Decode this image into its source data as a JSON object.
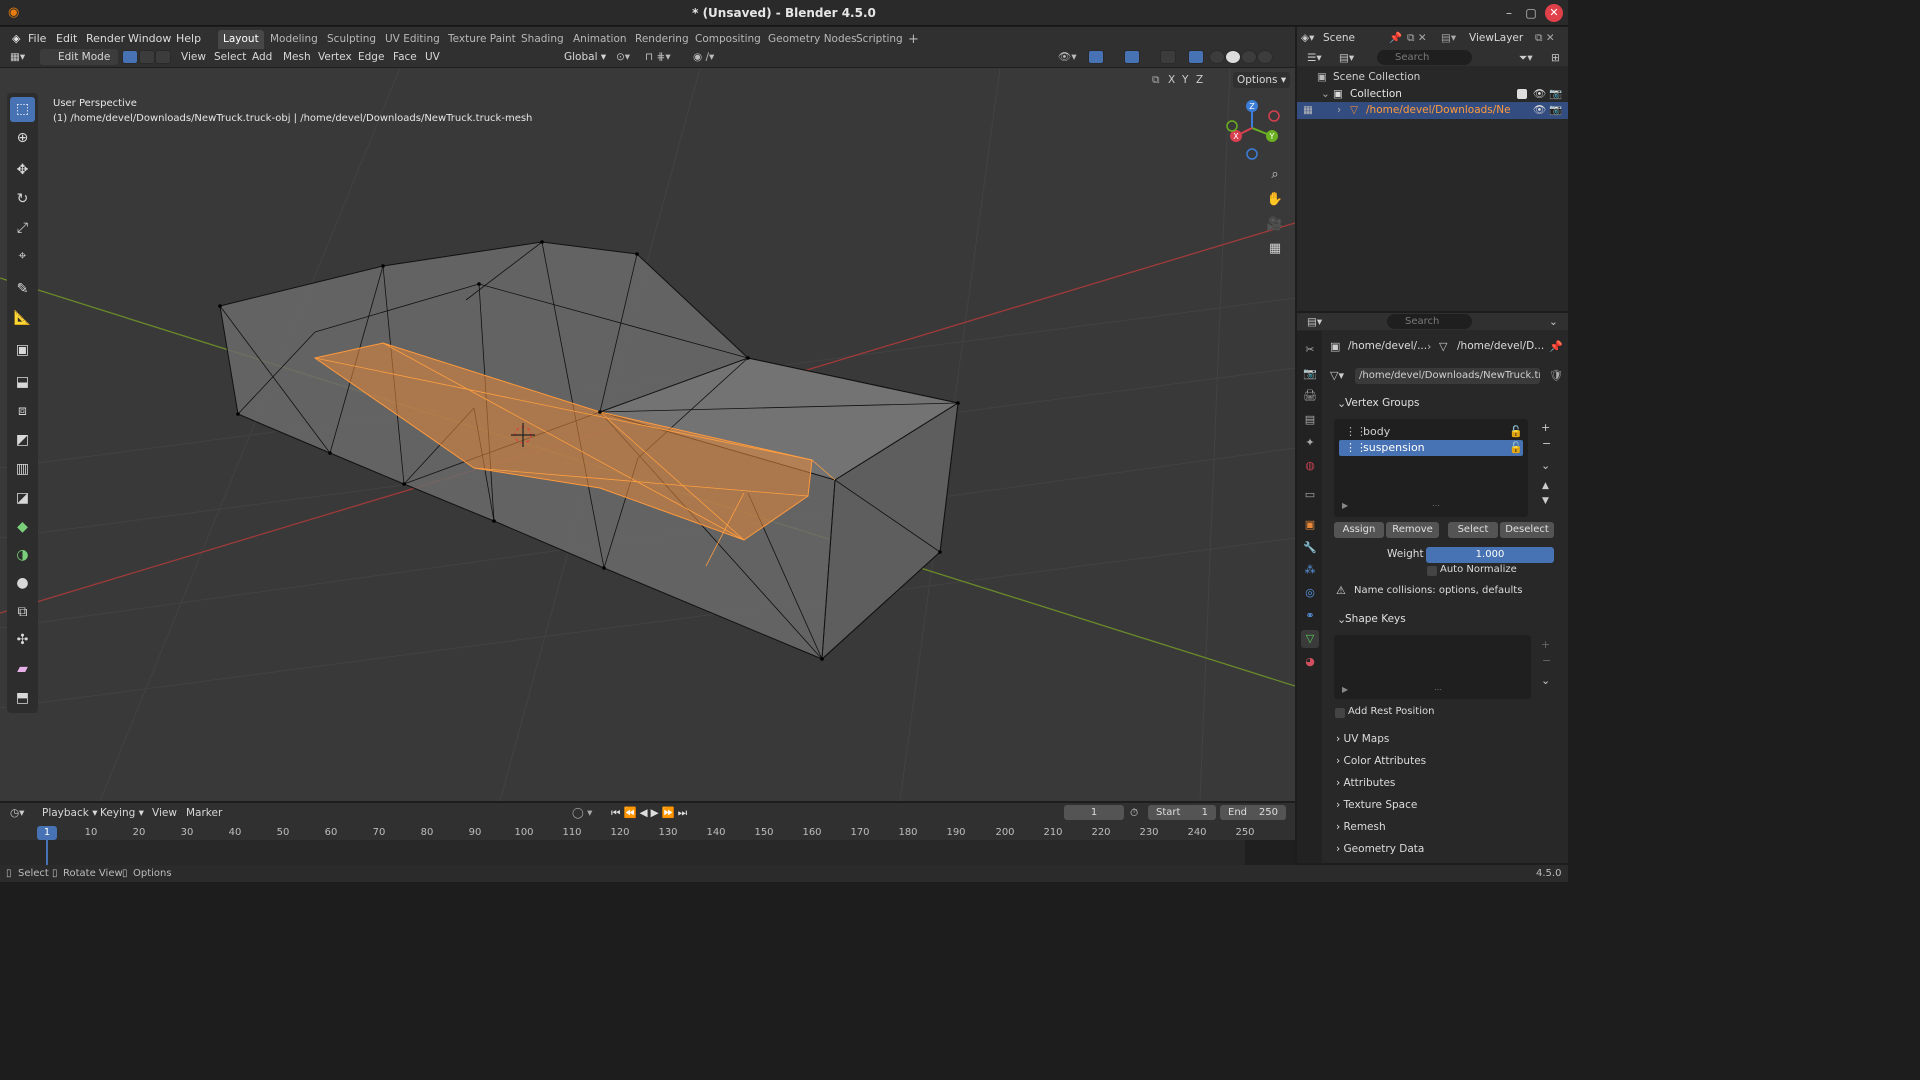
{
  "window": {
    "title": "* (Unsaved) - Blender 4.5.0",
    "min": "–",
    "max": "▢",
    "close": "✕"
  },
  "menu": {
    "items": [
      "File",
      "Edit",
      "Render",
      "Window",
      "Help"
    ]
  },
  "workspaces": [
    "Layout",
    "Modeling",
    "Sculpting",
    "UV Editing",
    "Texture Paint",
    "Shading",
    "Animation",
    "Rendering",
    "Compositing",
    "Geometry Nodes",
    "Scripting"
  ],
  "workspace_add": "+",
  "topright": {
    "scene": "Scene",
    "viewlayer": "ViewLayer"
  },
  "viewport_header": {
    "mode": "Edit Mode",
    "menus": [
      "View",
      "Select",
      "Add",
      "Mesh",
      "Vertex",
      "Edge",
      "Face",
      "UV"
    ],
    "orientation": "Global",
    "options": "Options",
    "axes": [
      "X",
      "Y",
      "Z"
    ]
  },
  "viewport": {
    "perspective": "User Perspective",
    "object_info": "(1) /home/devel/Downloads/NewTruck.truck-obj | /home/devel/Downloads/NewTruck.truck-mesh"
  },
  "gizmo": {
    "x": "X",
    "y": "Y",
    "z": "Z"
  },
  "outliner": {
    "search_placeholder": "Search",
    "scene_collection": "Scene Collection",
    "collection": "Collection",
    "object": "/home/devel/Downloads/NewTru"
  },
  "properties": {
    "search_placeholder": "Search",
    "breadcrumb1": "/home/devel/...",
    "breadcrumb2": "/home/devel/D...",
    "mesh_name": "/home/devel/Downloads/NewTruck.truc...",
    "vertex_groups_title": "Vertex Groups",
    "vertex_groups": [
      "body",
      "suspension"
    ],
    "buttons": {
      "assign": "Assign",
      "remove": "Remove",
      "select": "Select",
      "deselect": "Deselect"
    },
    "weight_label": "Weight",
    "weight_value": "1.000",
    "auto_normalize": "Auto Normalize",
    "warning": "Name collisions: options, defaults",
    "shape_keys_title": "Shape Keys",
    "add_rest_position": "Add Rest Position",
    "sections": [
      "UV Maps",
      "Color Attributes",
      "Attributes",
      "Texture Space",
      "Remesh",
      "Geometry Data"
    ]
  },
  "timeline": {
    "menus": [
      "Playback",
      "Keying",
      "View",
      "Marker"
    ],
    "current_frame": "1",
    "start_label": "Start",
    "start_value": "1",
    "end_label": "End",
    "end_value": "250",
    "ticks": [
      "1",
      "10",
      "20",
      "30",
      "40",
      "50",
      "60",
      "70",
      "80",
      "90",
      "100",
      "110",
      "120",
      "130",
      "140",
      "150",
      "160",
      "170",
      "180",
      "190",
      "200",
      "210",
      "220",
      "230",
      "240",
      "250"
    ]
  },
  "statusbar": {
    "select": "Select",
    "rotate": "Rotate View",
    "options": "Options",
    "version": "4.5.0"
  }
}
